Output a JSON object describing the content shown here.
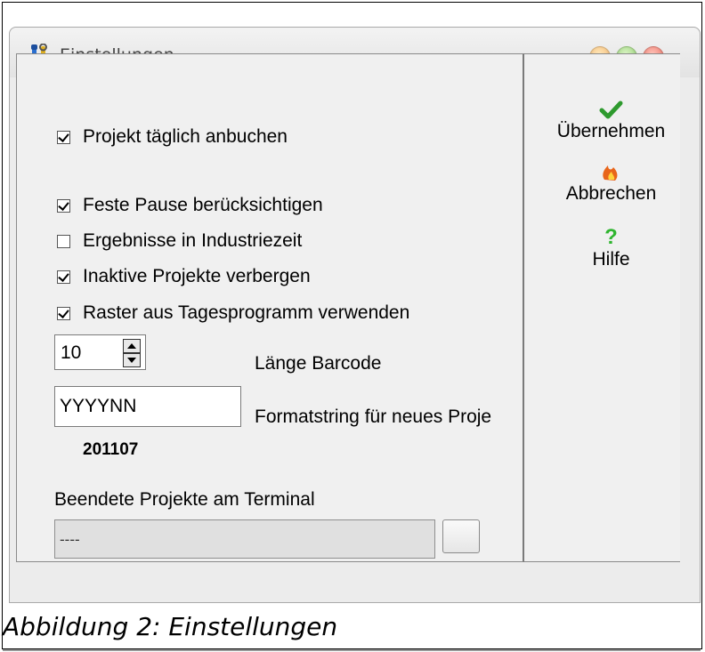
{
  "window": {
    "title": "Einstellungen"
  },
  "options": {
    "book_daily": {
      "label": "Projekt täglich anbuchen",
      "checked": true
    },
    "fixed_break": {
      "label": "Feste Pause berücksichtigen",
      "checked": true
    },
    "industrial_time": {
      "label": "Ergebnisse in Industriezeit",
      "checked": false
    },
    "hide_inactive": {
      "label": "Inaktive Projekte verbergen",
      "checked": true
    },
    "grid_from_day": {
      "label": "Raster aus Tagesprogramm verwenden",
      "checked": true
    }
  },
  "barcode": {
    "value": "10",
    "label": "Länge Barcode"
  },
  "format": {
    "value": "YYYYNN",
    "label": "Formatstring für neues Proje",
    "preview": "201107"
  },
  "terminal": {
    "label": "Beendete Projekte am Terminal",
    "value": "----"
  },
  "actions": {
    "apply": {
      "label": "Übernehmen",
      "icon": "check-icon",
      "color": "#2e9a2e"
    },
    "cancel": {
      "label": "Abbrechen",
      "icon": "flame-icon",
      "color": "#e8651a"
    },
    "help": {
      "label": "Hilfe",
      "icon": "question-icon",
      "color": "#2fb52f"
    }
  },
  "caption": "Abbildung 2: Einstellungen"
}
